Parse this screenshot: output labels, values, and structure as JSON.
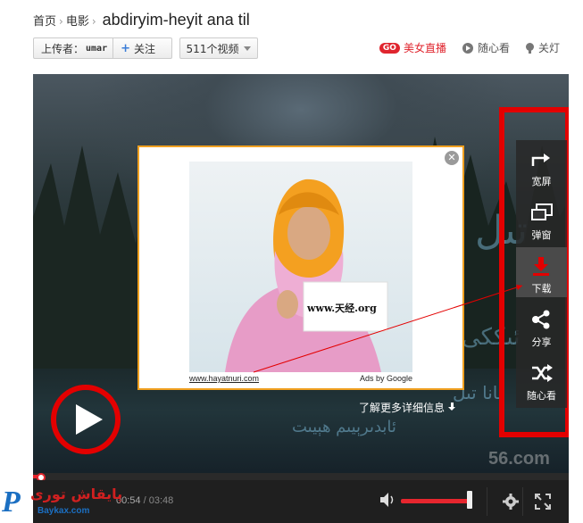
{
  "breadcrumb": {
    "home": "首页",
    "category": "电影",
    "separator": "›",
    "title": "abdiryim-heyit ana til"
  },
  "uploader": {
    "label": "上传者：",
    "name": "umar",
    "follow_label": "关注",
    "videos_label": "511个视频"
  },
  "top_links": {
    "go_badge": "GO",
    "live": "美女直播",
    "random": "随心看",
    "lights": "关灯"
  },
  "ad": {
    "sign_text": "www.天经.org",
    "link": "www.hayatnuri.com",
    "by": "Ads by Google",
    "close": "✕",
    "more_info": "了解更多详细信息"
  },
  "video_text": {
    "line_a": "ئانا تىل",
    "line_b": "ئابدىرېيىم ھېيىت",
    "line_c": "ئىككى",
    "line_d": "تىل",
    "watermark": "56.com"
  },
  "side_menu": [
    {
      "label": "宽屏",
      "icon": "widescreen-icon"
    },
    {
      "label": "弹窗",
      "icon": "popup-window-icon"
    },
    {
      "label": "下载",
      "icon": "download-icon"
    },
    {
      "label": "分享",
      "icon": "share-icon"
    },
    {
      "label": "随心看",
      "icon": "shuffle-icon"
    }
  ],
  "controls": {
    "time_current": "00:54",
    "time_sep": " / ",
    "time_total": "03:48",
    "progress": 0.02,
    "volume": 0.95
  },
  "watermark": {
    "letter": "P",
    "uyghur": "پايقاش تورى",
    "url": "Baykax.com"
  },
  "colors": {
    "accent_red": "#e30000",
    "progress_red": "#e6262e",
    "ad_border": "#f0a020"
  }
}
